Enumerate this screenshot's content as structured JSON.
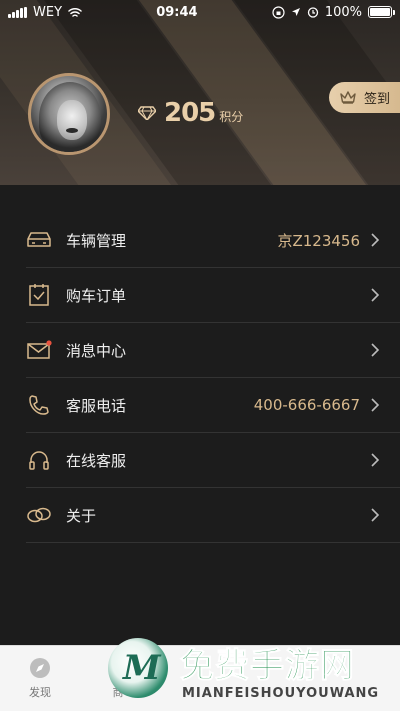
{
  "status_bar": {
    "carrier": "WEY",
    "time": "09:44",
    "battery": "100%"
  },
  "profile": {
    "points_value": "205",
    "points_unit": "积分",
    "signin_label": "签到"
  },
  "menu": [
    {
      "label": "车辆管理",
      "value": "京Z123456",
      "icon": "car-icon"
    },
    {
      "label": "购车订单",
      "value": "",
      "icon": "clipboard-check-icon"
    },
    {
      "label": "消息中心",
      "value": "",
      "icon": "mail-icon"
    },
    {
      "label": "客服电话",
      "value": "400-666-6667",
      "icon": "phone-icon"
    },
    {
      "label": "在线客服",
      "value": "",
      "icon": "headset-icon"
    },
    {
      "label": "关于",
      "value": "",
      "icon": "link-rings-icon"
    }
  ],
  "tabbar": {
    "discover_label": "发现",
    "second_label": "商"
  },
  "watermark": {
    "title": "免费手游网",
    "pinyin": "MIANFEISHOUYOUWANG"
  },
  "colors": {
    "accent": "#d8b98d",
    "background": "#1c1c1c",
    "tabbar": "#f5f5f5",
    "unread_dot": "#e8533f"
  }
}
